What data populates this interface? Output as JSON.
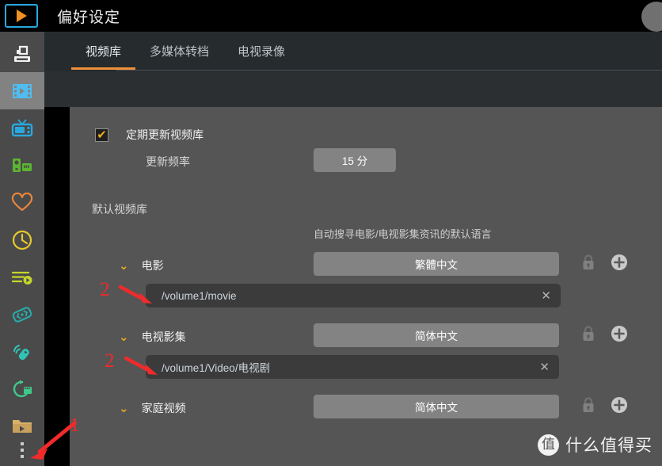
{
  "window": {
    "title": "偏好设定",
    "logo_icon": "tv-play-logo",
    "avatar_icon": "user-avatar"
  },
  "sidebar": {
    "items": [
      {
        "name": "sidebar-item-nas",
        "icon": "nas-printer-icon",
        "color": "#f2f2f2",
        "active": false
      },
      {
        "name": "sidebar-item-video",
        "icon": "film-strip-icon",
        "color": "#4fbdf0",
        "active": true
      },
      {
        "name": "sidebar-item-tv",
        "icon": "television-icon",
        "color": "#29a8e0",
        "active": false
      },
      {
        "name": "sidebar-item-device",
        "icon": "media-device-icon",
        "color": "#5cb531",
        "active": false
      },
      {
        "name": "sidebar-item-favorite",
        "icon": "heart-icon",
        "color": "#e8843c",
        "active": false
      },
      {
        "name": "sidebar-item-recent",
        "icon": "clock-icon",
        "color": "#e8c92c",
        "active": false
      },
      {
        "name": "sidebar-item-playlist",
        "icon": "playlist-play-icon",
        "color": "#c4d62b",
        "active": false
      },
      {
        "name": "sidebar-item-subtitle",
        "icon": "tag-subtitle-icon",
        "color": "#2aa8a8",
        "active": false
      },
      {
        "name": "sidebar-item-remote",
        "icon": "remote-signal-icon",
        "color": "#2ec4b6",
        "active": false
      },
      {
        "name": "sidebar-item-conversion",
        "icon": "convert-clapper-icon",
        "color": "#3ec98a",
        "active": false
      },
      {
        "name": "sidebar-item-folder",
        "icon": "folder-play-icon",
        "color": "#d9b06a",
        "active": false
      }
    ],
    "more_menu_icon": "more-vertical-icon"
  },
  "tabs": [
    {
      "label": "视频库",
      "active": true
    },
    {
      "label": "多媒体转档",
      "active": false
    },
    {
      "label": "电视录像",
      "active": false
    }
  ],
  "settings": {
    "auto_update": {
      "label": "定期更新视频库",
      "checked": true,
      "checkmark": "✔",
      "frequency_label": "更新频率",
      "frequency_value": "15 分"
    },
    "default_library": {
      "section_label": "默认视频库",
      "language_hint": "自动搜寻电影/电视影集资讯的默认语言",
      "chevron_icon": "chevron-down-icon",
      "lock_icon": "lock-icon",
      "add_icon": "plus-circle-icon",
      "clear_icon": "close-x-icon",
      "groups": [
        {
          "name": "电影",
          "language": "繁體中文",
          "paths": [
            "/volume1/movie"
          ]
        },
        {
          "name": "电视影集",
          "language": "简体中文",
          "paths": [
            "/volume1/Video/电视剧"
          ]
        },
        {
          "name": "家庭视频",
          "language": "简体中文",
          "paths": []
        }
      ]
    }
  },
  "annotations": [
    {
      "id": "anno-1",
      "label": "1",
      "target": "more-vertical-icon",
      "color": "#ef2b2b"
    },
    {
      "id": "anno-2a",
      "label": "2",
      "target": "movie-path-field",
      "color": "#ef2b2b"
    },
    {
      "id": "anno-2b",
      "label": "2",
      "target": "tv-path-field",
      "color": "#ef2b2b"
    }
  ],
  "watermark": {
    "badge": "值",
    "text": "什么值得买"
  }
}
